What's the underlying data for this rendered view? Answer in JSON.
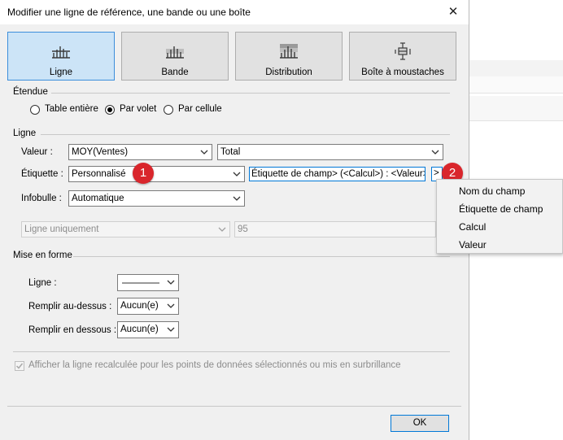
{
  "window": {
    "title": "Modifier une ligne de référence, une bande ou une boîte",
    "close_symbol": "✕"
  },
  "tiles": [
    {
      "label": "Ligne",
      "icon": "reference-line-icon",
      "selected": true
    },
    {
      "label": "Bande",
      "icon": "band-icon",
      "selected": false
    },
    {
      "label": "Distribution",
      "icon": "distribution-icon",
      "selected": false
    },
    {
      "label": "Boîte à moustaches",
      "icon": "box-plot-icon",
      "selected": false
    }
  ],
  "scope": {
    "heading": "Étendue",
    "options": [
      "Table entière",
      "Par volet",
      "Par cellule"
    ],
    "selected": "Par volet"
  },
  "line": {
    "heading": "Ligne",
    "value_label": "Valeur :",
    "value_field": "MOY(Ventes)",
    "value_aggregation": "Total",
    "label_label": "Étiquette :",
    "label_type": "Personnalisé",
    "label_custom_text": "Étiquette de champ> (<Calcul>) : <Valeur>",
    "insert_button": ">",
    "tooltip_label": "Infobulle :",
    "tooltip_value": "Automatique",
    "confidence_mode": "Ligne uniquement",
    "confidence_value": "95"
  },
  "badges": {
    "first": "1",
    "second": "2"
  },
  "insert_menu": {
    "items": [
      "Nom du champ",
      "Étiquette de champ",
      "Calcul",
      "Valeur"
    ]
  },
  "formatting": {
    "heading": "Mise en forme",
    "line_label": "Ligne :",
    "fill_above_label": "Remplir au-dessus :",
    "fill_above_value": "Aucun(e)",
    "fill_below_label": "Remplir en dessous :",
    "fill_below_value": "Aucun(e)"
  },
  "recalc_checkbox": {
    "label": "Afficher la ligne recalculée pour les points de données sélectionnés ou mis en surbrillance",
    "checked": true,
    "enabled": false
  },
  "ok_button": "OK",
  "colors": {
    "accent": "#0078d7",
    "selected_tile": "#cce4f7",
    "badge": "#d9262c"
  }
}
